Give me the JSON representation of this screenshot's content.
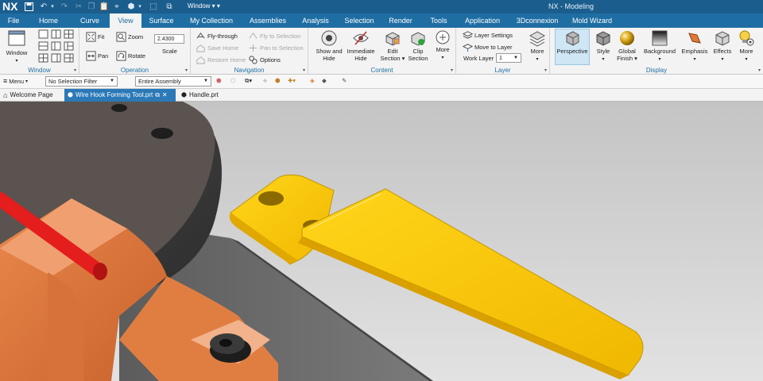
{
  "title_bar": {
    "logo": "NX",
    "app_title": "NX - Modeling",
    "window_menu": "Window ▾ ▾"
  },
  "menu_tabs": [
    "File",
    "Home",
    "Curve",
    "View",
    "Surface",
    "My Collection",
    "Assemblies",
    "Analysis",
    "Selection",
    "Render",
    "Tools",
    "Application",
    "3Dconnexion",
    "Mold Wizard"
  ],
  "ribbon": {
    "window_group": {
      "label": "Window",
      "button": "Window"
    },
    "operation_group": {
      "label": "Operation",
      "fit": "Fit",
      "pan": "Pan",
      "zoom": "Zoom",
      "rotate": "Rotate",
      "scale_value": "2.4300",
      "scale_label": "Scale"
    },
    "navigation_group": {
      "label": "Navigation",
      "fly_through": "Fly-through",
      "save_home": "Save Home",
      "restore_home": "Restore Home",
      "fly_to_selection": "Fly to Selection",
      "pan_to_selection": "Pan to Selection",
      "options": "Options"
    },
    "content_group": {
      "label": "Content",
      "show_and_hide": "Show and Hide",
      "immediate_hide": "Immediate Hide",
      "edit_section": "Edit Section",
      "clip_section": "Clip Section",
      "more": "More"
    },
    "layer_group": {
      "label": "Layer",
      "layer_settings": "Layer Settings",
      "move_to_layer": "Move to Layer",
      "work_layer_label": "Work Layer",
      "work_layer_value": "1",
      "more": "More"
    },
    "display_group": {
      "label": "Display",
      "perspective": "Perspective",
      "style": "Style",
      "global_finish": "Global Finish",
      "background": "Background",
      "emphasis": "Emphasis",
      "effects": "Effects",
      "more": "More"
    }
  },
  "command_bar": {
    "menu": "Menu",
    "selection_filter": "No Selection Filter",
    "assembly_scope": "Entire Assembly"
  },
  "doc_tabs": [
    {
      "label": "Welcome Page"
    },
    {
      "label": "Wire Hook Forming Tool.prt"
    },
    {
      "label": "Handle.prt"
    }
  ],
  "colors": {
    "title_bar": "#1b5e8e",
    "menu_bar": "#1f6ea3",
    "active_doc_tab": "#2b79b7",
    "part_yellow": "#f5c400",
    "part_copper": "#d9773f",
    "wire_red": "#e41d1d"
  }
}
